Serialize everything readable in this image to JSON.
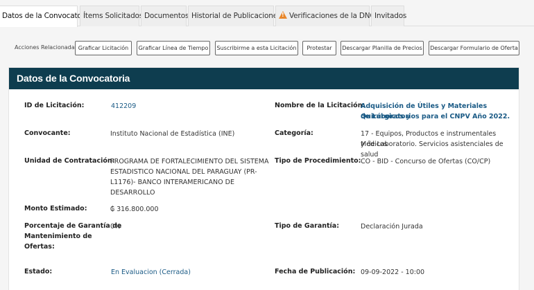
{
  "tabs": [
    {
      "label": "Datos de la Convocatoria",
      "active": true
    },
    {
      "label": "Ítems Solicitados"
    },
    {
      "label": "Documentos"
    },
    {
      "label": "Historial de Publicaciones"
    },
    {
      "label": "Verificaciones de la DNCP",
      "icon": "warning-icon"
    },
    {
      "label": "Invitados"
    }
  ],
  "actions": {
    "label": "Acciones Relacionadas:",
    "buttons": [
      "Graficar Licitación",
      "Graficar Línea de Tiempo",
      "Suscribirme a esta Licitación",
      "Protestar",
      "Descargar Planilla de Precios",
      "Descargar Formulario de Oferta"
    ]
  },
  "panel": {
    "title": "Datos de la Convocatoria",
    "fields": {
      "id_label": "ID de Licitación:",
      "id_value": "412209",
      "nombre_label": "Nombre de la Licitación:",
      "nombre_line1": "Adquisición de Útiles y Materiales Quirúrgicos y",
      "nombre_line2": "de Laboratorios para el CNPV Año 2022.",
      "convocante_label": "Convocante:",
      "convocante_value": "Instituto Nacional de Estadística (INE)",
      "categoria_label": "Categoría:",
      "categoria_line1": "17 - Equipos, Productos e instrumentales Médicos",
      "categoria_line2": "y de Laboratorio. Servicios asistenciales de salud",
      "unidad_label": "Unidad de Contratación:",
      "unidad_line1": "PROGRAMA DE FORTALECIMIENTO DEL SISTEMA",
      "unidad_line2": "ESTADISTICO NACIONAL DEL PARAGUAY (PR-",
      "unidad_line3": "L1176)- BANCO INTERAMERICANO DE",
      "unidad_line4": "DESARROLLO",
      "tipo_proc_label": "Tipo de Procedimiento:",
      "tipo_proc_value": "CO - BID - Concurso de Ofertas (CO/CP)",
      "monto_label": "Monto Estimado:",
      "monto_value": "₲ 316.800.000",
      "garantia_pct_line1": "Porcentaje de Garantía de",
      "garantia_pct_line2": "Mantenimiento de",
      "garantia_pct_line3": "Ofertas:",
      "garantia_pct_value": "0%",
      "tipo_garantia_label": "Tipo de Garantía:",
      "tipo_garantia_value": "Declaración Jurada",
      "estado_label": "Estado:",
      "estado_value": "En Evaluacion (Cerrada)",
      "fecha_label": "Fecha de Publicación:",
      "fecha_value": "09-09-2022 - 10:00"
    }
  }
}
